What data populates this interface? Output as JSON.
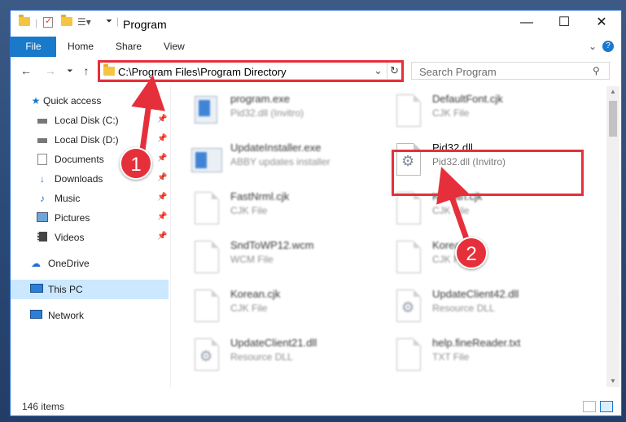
{
  "window": {
    "title": "Program",
    "controls": {
      "minimize": "—",
      "maximize": "☐",
      "close": "✕"
    }
  },
  "ribbon": {
    "tabs": [
      "File",
      "Home",
      "Share",
      "View"
    ],
    "expand": "⌄",
    "help": "?"
  },
  "address_bar": {
    "path": "C:\\Program Files\\Program Directory",
    "dropdown": "⌄",
    "refresh": "↻"
  },
  "search": {
    "placeholder": "Search Program"
  },
  "nav": {
    "items": [
      {
        "label": "Quick access",
        "icon": "star-icon"
      },
      {
        "label": "Local Disk (C:)",
        "icon": "drive-icon",
        "pinned": true
      },
      {
        "label": "Local Disk (D:)",
        "icon": "drive-icon",
        "pinned": true
      },
      {
        "label": "Documents",
        "icon": "documents-icon",
        "pinned": true
      },
      {
        "label": "Downloads",
        "icon": "download-icon",
        "pinned": true
      },
      {
        "label": "Music",
        "icon": "music-icon",
        "pinned": true
      },
      {
        "label": "Pictures",
        "icon": "pictures-icon",
        "pinned": true
      },
      {
        "label": "Videos",
        "icon": "videos-icon",
        "pinned": true
      },
      {
        "label": "OneDrive",
        "icon": "cloud-icon"
      },
      {
        "label": "This PC",
        "icon": "computer-icon",
        "selected": true
      },
      {
        "label": "Network",
        "icon": "network-icon"
      }
    ]
  },
  "files": [
    {
      "name": "program.exe",
      "desc": "Pid32.dll (Invitro)",
      "icon": "installer-icon"
    },
    {
      "name": "DefaultFont.cjk",
      "desc": "CJK File",
      "icon": "document-icon"
    },
    {
      "name": "UpdateInstaller.exe",
      "desc": "ABBY updates installer",
      "icon": "exe-icon"
    },
    {
      "name": "Pid32.dll",
      "desc": "Pid32.dll (Invitro)",
      "icon": "dll-gear-icon",
      "highlighted": true
    },
    {
      "name": "FastNrml.cjk",
      "desc": "CJK File",
      "icon": "document-icon"
    },
    {
      "name": "Korean.cjk",
      "desc": "CJK File",
      "icon": "document-icon"
    },
    {
      "name": "SndToWP12.wcm",
      "desc": "WCM File",
      "icon": "document-icon"
    },
    {
      "name": "Korean.cjk",
      "desc": "CJK File",
      "icon": "document-icon"
    },
    {
      "name": "Korean.cjk",
      "desc": "CJK File",
      "icon": "document-icon"
    },
    {
      "name": "UpdateClient42.dll",
      "desc": "Resource DLL",
      "icon": "dll-gear-icon"
    },
    {
      "name": "UpdateClient21.dll",
      "desc": "Resource DLL",
      "icon": "dll-gear-icon"
    },
    {
      "name": "help.fineReader.txt",
      "desc": "TXT File",
      "icon": "text-icon"
    }
  ],
  "status": {
    "items_count": "146 items"
  },
  "annotations": {
    "step1": "1",
    "step2": "2"
  },
  "colors": {
    "accent": "#1979ca",
    "highlight": "#e5303b",
    "selected": "#cce8ff"
  }
}
